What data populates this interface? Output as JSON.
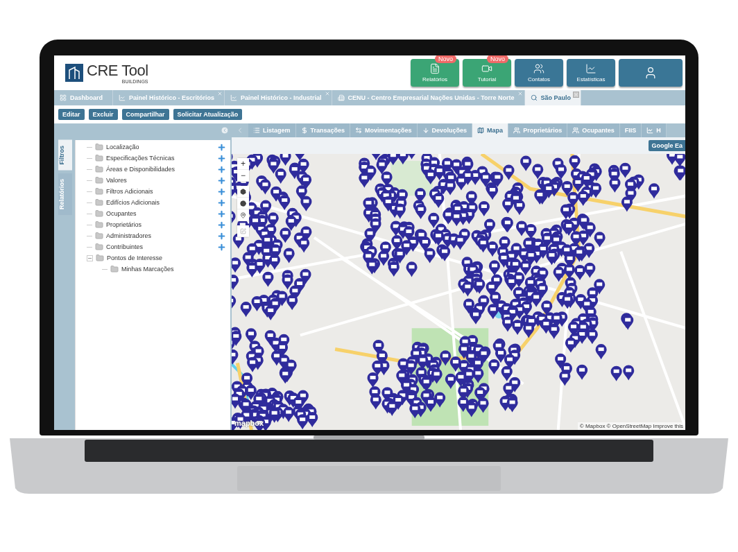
{
  "header": {
    "logo_text": "CRE Tool",
    "logo_subtext": "BUILDINGS",
    "buttons": [
      {
        "kind": "report",
        "label": "Relatórios",
        "badge": "Novo",
        "color": "#3ba575"
      },
      {
        "kind": "video",
        "label": "Tutorial",
        "badge": "Novo",
        "color": "#3ba575"
      },
      {
        "kind": "people",
        "label": "Contatos",
        "color": "#3a7696"
      },
      {
        "kind": "chart",
        "label": "Estatísticas",
        "color": "#3a7696"
      },
      {
        "kind": "user",
        "color": "#3a7696"
      }
    ]
  },
  "tabs": [
    {
      "kind": "grid",
      "label": "Dashboard",
      "closable": false,
      "selected": false
    },
    {
      "kind": "chart",
      "label": "Painel Histórico - Escritórios",
      "closable": true,
      "selected": false
    },
    {
      "kind": "chart",
      "label": "Painel Histórico - Industrial",
      "closable": true,
      "selected": false
    },
    {
      "kind": "building",
      "label": "CENU - Centro Empresarial Nações Unidas - Torre Norte",
      "closable": true,
      "selected": false
    },
    {
      "kind": "search",
      "label": "São Paulo",
      "closable": true,
      "selected": true
    }
  ],
  "toolbar": [
    "Editar",
    "Excluir",
    "Compartilhar",
    "Solicitar Atualização"
  ],
  "side_tabs": [
    {
      "label": "Filtros",
      "selected": true
    },
    {
      "label": "Relatórios",
      "selected": false
    }
  ],
  "tree": [
    {
      "label": "Localização",
      "add_button": true
    },
    {
      "label": "Especificações Técnicas",
      "add_button": true
    },
    {
      "label": "Áreas e Disponibilidades",
      "add_button": true
    },
    {
      "label": "Valores",
      "add_button": true
    },
    {
      "label": "Filtros Adicionais",
      "add_button": true
    },
    {
      "label": "Edifícios Adicionais",
      "add_button": true
    },
    {
      "label": "Ocupantes",
      "add_button": true
    },
    {
      "label": "Proprietários",
      "add_button": true
    },
    {
      "label": "Administradores",
      "add_button": true
    },
    {
      "label": "Contribuintes",
      "add_button": true
    },
    {
      "label": "Pontos de Interesse",
      "add_button": false,
      "expanded": true,
      "children": [
        {
          "label": "Minhas Marcações",
          "add_button": false
        }
      ]
    }
  ],
  "view_tabs": [
    {
      "kind": "list",
      "label": "Listagem",
      "selected": false
    },
    {
      "kind": "dollar",
      "label": "Transações",
      "selected": false
    },
    {
      "kind": "swap",
      "label": "Movimentações",
      "selected": false
    },
    {
      "kind": "down",
      "label": "Devoluções",
      "selected": false
    },
    {
      "kind": "map",
      "label": "Mapa",
      "selected": true
    },
    {
      "kind": "people",
      "label": "Proprietários",
      "selected": false
    },
    {
      "kind": "people",
      "label": "Ocupantes",
      "selected": false
    },
    {
      "kind": "none",
      "label": "FIIS",
      "selected": false
    },
    {
      "kind": "chart",
      "label": "H",
      "selected": false
    }
  ],
  "map": {
    "google_button": "Google Ea",
    "zoom_in": "+",
    "zoom_out": "−",
    "logo": "mapbox",
    "attribution": "© Mapbox © OpenStreetMap Improve this"
  }
}
